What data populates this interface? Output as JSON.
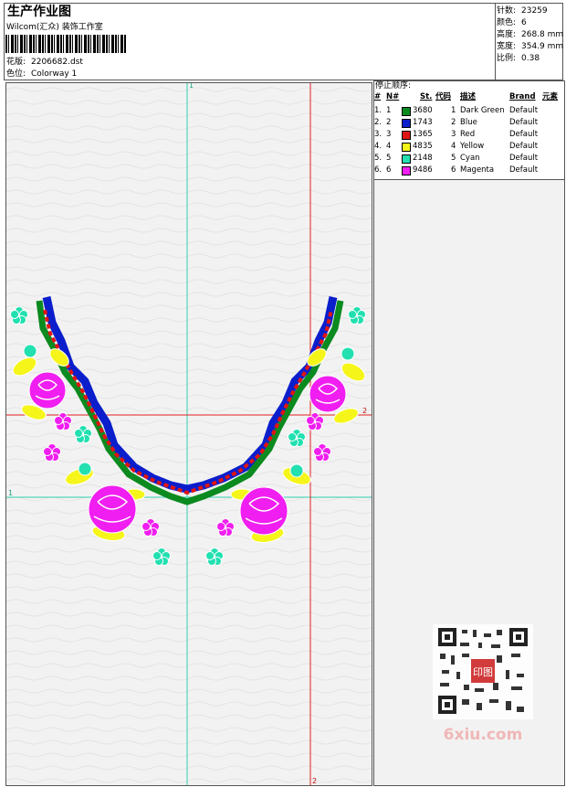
{
  "header": {
    "title": "生产作业图",
    "company": "Wilcom(汇众) 装饰工作室",
    "pattern_label": "花版:",
    "pattern_value": "2206682.dst",
    "colorway_label": "色位:",
    "colorway_value": "Colorway 1"
  },
  "stats": {
    "stitches_label": "针数:",
    "stitches_value": "23259",
    "colors_label": "颜色:",
    "colors_value": "6",
    "height_label": "高度:",
    "height_value": "268.8 mm",
    "width_label": "宽度:",
    "width_value": "354.9 mm",
    "scale_label": "比例:",
    "scale_value": "0.38"
  },
  "stop_sequence": {
    "title": "停止顺序:",
    "headers": [
      "#",
      "N#",
      "St.",
      "代码",
      "描述",
      "Brand",
      "元素"
    ],
    "rows": [
      {
        "n": "1.",
        "nn": "1",
        "color": "#0a8a1f",
        "st": "3680",
        "code": "1",
        "desc": "Dark Green",
        "brand": "Default"
      },
      {
        "n": "2.",
        "nn": "2",
        "color": "#0a1ecc",
        "st": "1743",
        "code": "2",
        "desc": "Blue",
        "brand": "Default"
      },
      {
        "n": "3.",
        "nn": "3",
        "color": "#e01414",
        "st": "1365",
        "code": "3",
        "desc": "Red",
        "brand": "Default"
      },
      {
        "n": "4.",
        "nn": "4",
        "color": "#f5f51a",
        "st": "4835",
        "code": "4",
        "desc": "Yellow",
        "brand": "Default"
      },
      {
        "n": "5.",
        "nn": "5",
        "color": "#22e0b0",
        "st": "2148",
        "code": "5",
        "desc": "Cyan",
        "brand": "Default"
      },
      {
        "n": "6.",
        "nn": "6",
        "color": "#f01ef0",
        "st": "9486",
        "code": "6",
        "desc": "Magenta",
        "brand": "Default"
      }
    ]
  },
  "design": {
    "guide_top_label": "1",
    "guide_left_label": "1",
    "guide_right_label": "2",
    "guide_bottom_label": "2"
  },
  "watermark": {
    "brand": "6xiu.com",
    "seal": "印图"
  }
}
